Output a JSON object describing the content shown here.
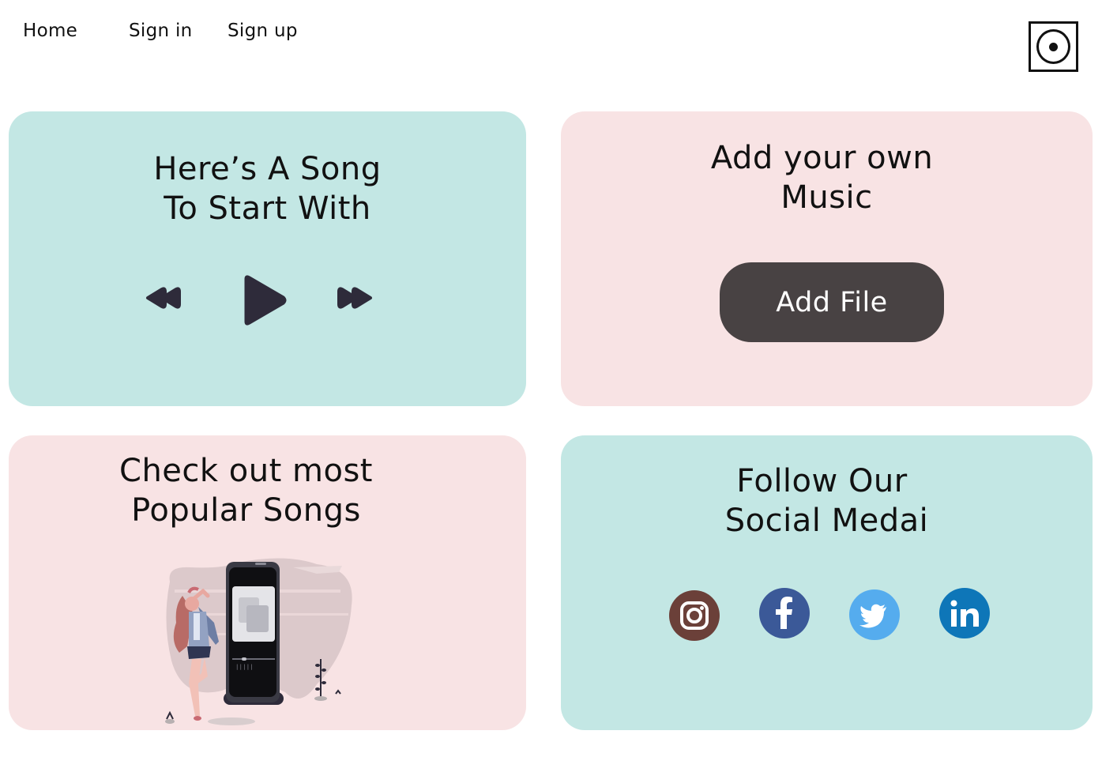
{
  "nav": {
    "home": "Home",
    "sign_in": "Sign in",
    "sign_up": "Sign up"
  },
  "logo": {
    "icon": "record-disc-icon"
  },
  "player_card": {
    "title_line1": "Here’s A Song",
    "title_line2": "To Start With",
    "controls": [
      "rewind-icon",
      "play-icon",
      "fast-forward-icon"
    ]
  },
  "upload_card": {
    "title_line1": "Add your own",
    "title_line2": "Music",
    "button_label": "Add File"
  },
  "popular_card": {
    "title_line1": "Check out most",
    "title_line2": "Popular Songs"
  },
  "social_card": {
    "title_line1": "Follow Our",
    "title_line2": "Social Medai",
    "links": [
      "instagram-icon",
      "facebook-icon",
      "twitter-icon",
      "linkedin-icon"
    ]
  },
  "colors": {
    "teal_card": "#c3e7e4",
    "pink_card": "#f8e3e4",
    "button": "#484243",
    "control": "#2e2b3a",
    "instagram": "#6b4039",
    "facebook": "#3b5998",
    "twitter": "#55acee",
    "linkedin": "#0e76b8"
  }
}
